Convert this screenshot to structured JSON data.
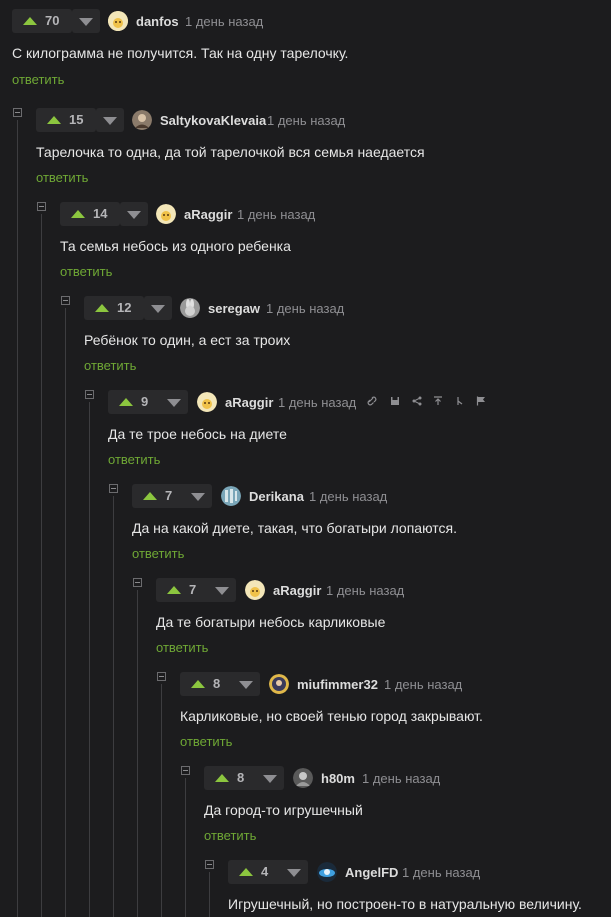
{
  "reply_label": "ответить",
  "comments": [
    {
      "score": "70",
      "user": "danfos",
      "time": "1 день назад",
      "text": "С килограмма не получится. Так на одну тарелочку."
    },
    {
      "score": "15",
      "user": "SaltykovaKlevaia",
      "time": "1 день назад",
      "text": "Тарелочка то одна, да той тарелочкой вся семья наедается"
    },
    {
      "score": "14",
      "user": "aRaggir",
      "time": "1 день назад",
      "text": "Та семья небось из одного ребенка"
    },
    {
      "score": "12",
      "user": "seregaw",
      "time": "1 день назад",
      "text": "Ребёнок то один, а ест за троих"
    },
    {
      "score": "9",
      "user": "aRaggir",
      "time": "1 день назад",
      "text": "Да те трое небось на диете"
    },
    {
      "score": "7",
      "user": "Derikana",
      "time": "1 день назад",
      "text": "Да на какой диете, такая, что богатыри лопаются."
    },
    {
      "score": "7",
      "user": "aRaggir",
      "time": "1 день назад",
      "text": "Да те богатыри небось карликовые"
    },
    {
      "score": "8",
      "user": "miufimmer32",
      "time": "1 день назад",
      "text": "Карликовые, но своей тенью город закрывают."
    },
    {
      "score": "8",
      "user": "h80m",
      "time": "1 день назад",
      "text": "Да город-то игрушечный"
    },
    {
      "score": "4",
      "user": "AngelFD",
      "time": "1 день назад",
      "text": "Игрушечный, но построен-то в натуральную величину."
    }
  ],
  "colors": {
    "background": "#1c1c1e",
    "accent": "#8cc63f",
    "reply": "#6fa835",
    "muted": "#8e8e92"
  },
  "icons": [
    "link-icon",
    "save-icon",
    "share-icon",
    "scroll-to-parent-icon",
    "branch-icon",
    "report-flag-icon"
  ]
}
